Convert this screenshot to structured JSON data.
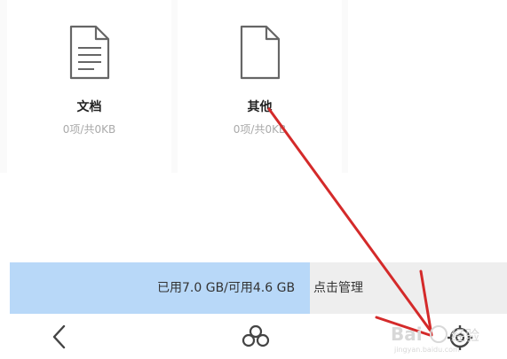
{
  "categories": [
    {
      "icon": "document-icon",
      "label": "文档",
      "summary": "0项/共0KB"
    },
    {
      "icon": "blank-file-icon",
      "label": "其他",
      "summary": "0项/共0KB"
    }
  ],
  "storage": {
    "used_text": "已用7.0 GB/可用4.6 GB",
    "manage_label": "点击管理",
    "used_fraction": 0.603,
    "fill_color": "#b8d8f8"
  },
  "bottom_nav": {
    "back_icon": "back-arrow-icon",
    "share_icon": "share-icon",
    "settings_icon": "settings-icon"
  },
  "annotation": {
    "arrow_color": "#d42a2a",
    "watermark": "Baidu 经验"
  }
}
